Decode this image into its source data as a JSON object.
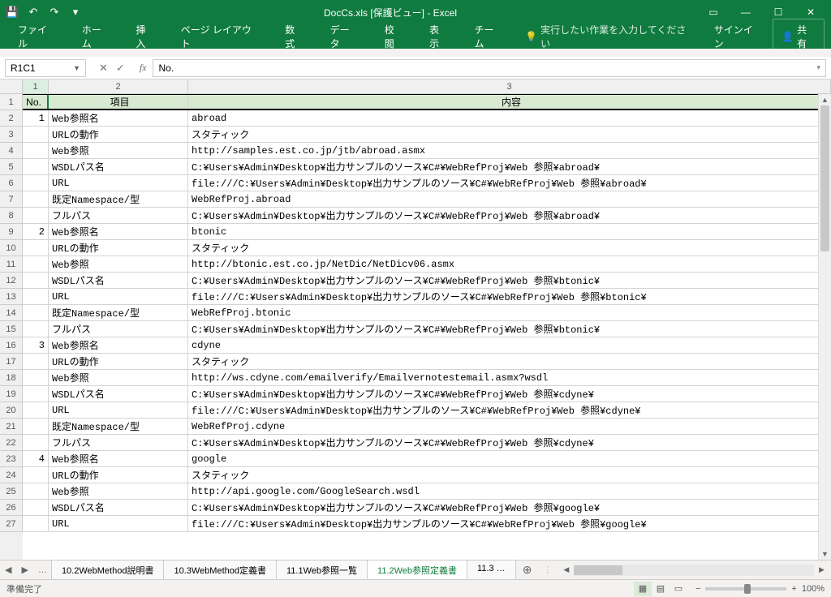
{
  "title": "DocCs.xls  [保護ビュー] - Excel",
  "qat": {
    "save": "💾",
    "undo": "↶",
    "redo": "↷",
    "more": "▾"
  },
  "winctrl": {
    "ribbonopt": "▭",
    "min": "—",
    "max": "☐",
    "close": "✕"
  },
  "ribbon": {
    "tabs": [
      "ファイル",
      "ホーム",
      "挿入",
      "ページ レイアウト",
      "数式",
      "データ",
      "校閲",
      "表示",
      "チーム"
    ],
    "tellme_icon": "💡",
    "tellme": "実行したい作業を入力してください",
    "signin": "サインイン",
    "share_icon": "👤",
    "share": "共有"
  },
  "namebox": "R1C1",
  "fx": "No.",
  "cols": {
    "c1": "1",
    "c2": "2",
    "c3": "3"
  },
  "header": {
    "a": "No.",
    "b": "項目",
    "c": "内容"
  },
  "rows": [
    {
      "n": "2",
      "a": "1",
      "b": "Web参照名",
      "c": "abroad"
    },
    {
      "n": "3",
      "a": "",
      "b": "URLの動作",
      "c": "スタティック"
    },
    {
      "n": "4",
      "a": "",
      "b": "Web参照",
      "c": "http://samples.est.co.jp/jtb/abroad.asmx"
    },
    {
      "n": "5",
      "a": "",
      "b": "WSDLパス名",
      "c": "C:¥Users¥Admin¥Desktop¥出力サンプルのソース¥C#¥WebRefProj¥Web 参照¥abroad¥"
    },
    {
      "n": "6",
      "a": "",
      "b": "URL",
      "c": "file:///C:¥Users¥Admin¥Desktop¥出力サンプルのソース¥C#¥WebRefProj¥Web 参照¥abroad¥"
    },
    {
      "n": "7",
      "a": "",
      "b": "既定Namespace/型",
      "c": "WebRefProj.abroad"
    },
    {
      "n": "8",
      "a": "",
      "b": "フルパス",
      "c": "C:¥Users¥Admin¥Desktop¥出力サンプルのソース¥C#¥WebRefProj¥Web 参照¥abroad¥"
    },
    {
      "n": "9",
      "a": "2",
      "b": "Web参照名",
      "c": "btonic"
    },
    {
      "n": "10",
      "a": "",
      "b": "URLの動作",
      "c": "スタティック"
    },
    {
      "n": "11",
      "a": "",
      "b": "Web参照",
      "c": "http://btonic.est.co.jp/NetDic/NetDicv06.asmx"
    },
    {
      "n": "12",
      "a": "",
      "b": "WSDLパス名",
      "c": "C:¥Users¥Admin¥Desktop¥出力サンプルのソース¥C#¥WebRefProj¥Web 参照¥btonic¥"
    },
    {
      "n": "13",
      "a": "",
      "b": "URL",
      "c": "file:///C:¥Users¥Admin¥Desktop¥出力サンプルのソース¥C#¥WebRefProj¥Web 参照¥btonic¥"
    },
    {
      "n": "14",
      "a": "",
      "b": "既定Namespace/型",
      "c": "WebRefProj.btonic"
    },
    {
      "n": "15",
      "a": "",
      "b": "フルパス",
      "c": "C:¥Users¥Admin¥Desktop¥出力サンプルのソース¥C#¥WebRefProj¥Web 参照¥btonic¥"
    },
    {
      "n": "16",
      "a": "3",
      "b": "Web参照名",
      "c": "cdyne"
    },
    {
      "n": "17",
      "a": "",
      "b": "URLの動作",
      "c": "スタティック"
    },
    {
      "n": "18",
      "a": "",
      "b": "Web参照",
      "c": "http://ws.cdyne.com/emailverify/Emailvernotestemail.asmx?wsdl"
    },
    {
      "n": "19",
      "a": "",
      "b": "WSDLパス名",
      "c": "C:¥Users¥Admin¥Desktop¥出力サンプルのソース¥C#¥WebRefProj¥Web 参照¥cdyne¥"
    },
    {
      "n": "20",
      "a": "",
      "b": "URL",
      "c": "file:///C:¥Users¥Admin¥Desktop¥出力サンプルのソース¥C#¥WebRefProj¥Web 参照¥cdyne¥"
    },
    {
      "n": "21",
      "a": "",
      "b": "既定Namespace/型",
      "c": "WebRefProj.cdyne"
    },
    {
      "n": "22",
      "a": "",
      "b": "フルパス",
      "c": "C:¥Users¥Admin¥Desktop¥出力サンプルのソース¥C#¥WebRefProj¥Web 参照¥cdyne¥"
    },
    {
      "n": "23",
      "a": "4",
      "b": "Web参照名",
      "c": "google"
    },
    {
      "n": "24",
      "a": "",
      "b": "URLの動作",
      "c": "スタティック"
    },
    {
      "n": "25",
      "a": "",
      "b": "Web参照",
      "c": "http://api.google.com/GoogleSearch.wsdl"
    },
    {
      "n": "26",
      "a": "",
      "b": "WSDLパス名",
      "c": "C:¥Users¥Admin¥Desktop¥出力サンプルのソース¥C#¥WebRefProj¥Web 参照¥google¥"
    },
    {
      "n": "27",
      "a": "",
      "b": "URL",
      "c": "file:///C:¥Users¥Admin¥Desktop¥出力サンプルのソース¥C#¥WebRefProj¥Web 参照¥google¥"
    }
  ],
  "sheettabs": {
    "dots": "…",
    "list": [
      {
        "label": "10.2WebMethod説明書",
        "active": false
      },
      {
        "label": "10.3WebMethod定義書",
        "active": false
      },
      {
        "label": "11.1Web参照一覧",
        "active": false
      },
      {
        "label": "11.2Web参照定義書",
        "active": true
      },
      {
        "label": "11.3 …",
        "active": false
      }
    ],
    "plus": "⊕"
  },
  "status": {
    "ready": "準備完了",
    "zoom": "100%",
    "minus": "−",
    "plus": "+"
  }
}
